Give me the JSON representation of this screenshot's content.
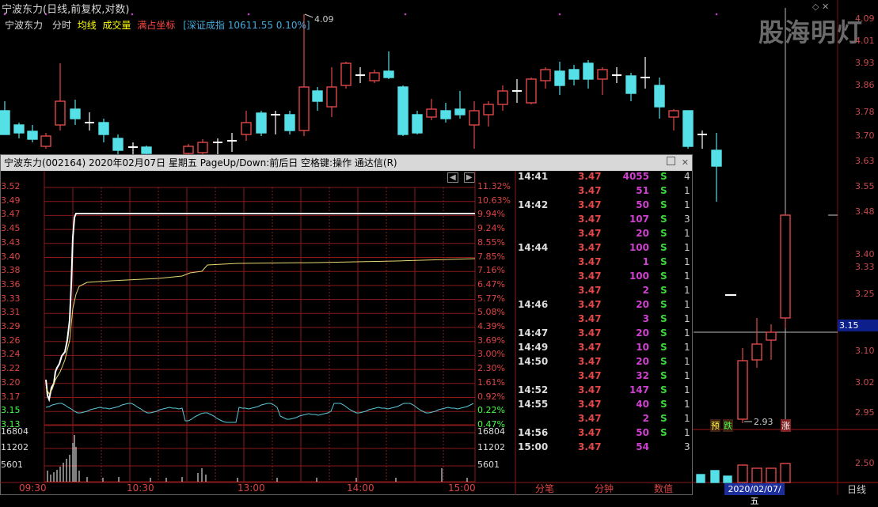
{
  "window_title": "宁波东力(日线,前复权,对数)",
  "watermark": "股海明灯",
  "top_icons": "◇ ✕",
  "right_axis": [
    "4.09",
    "4.01",
    "3.93",
    "3.86",
    "3.78",
    "3.70",
    "3.63",
    "3.55",
    "3.48",
    "3.40",
    "3.33",
    "3.25",
    "3.15",
    "3.10",
    "3.02",
    "2.95",
    "2.50"
  ],
  "current_price": "3.15",
  "annotations": {
    "high": "4.09",
    "low": "2.93",
    "yu": "预",
    "die": "跌",
    "zhang": "涨"
  },
  "bottom": {
    "date": "2020/02/07/五",
    "daily": "日线"
  },
  "popup": {
    "title": "宁波东力(002164)  2020年02月07日 星期五  PageUp/Down:前后日  空格键:操作  通达信(R)",
    "sub_name": "宁波东力",
    "sub_tabs": [
      "分时",
      "均线",
      "成交量",
      "满占坐标"
    ],
    "index_info": "[深证成指 10611.55 0.10%]",
    "y_prices": [
      "3.52",
      "3.49",
      "3.47",
      "3.45",
      "3.43",
      "3.40",
      "3.38",
      "3.36",
      "3.33",
      "3.31",
      "3.29",
      "3.26",
      "3.24",
      "3.22",
      "3.20",
      "3.17",
      "3.15",
      "3.13"
    ],
    "y_pcts": [
      "11.32%",
      "10.63%",
      "9.94%",
      "9.24%",
      "8.55%",
      "7.85%",
      "7.16%",
      "6.47%",
      "5.77%",
      "5.08%",
      "4.39%",
      "3.69%",
      "3.00%",
      "2.30%",
      "1.61%",
      "0.92%",
      "0.22%",
      "0.47%"
    ],
    "vol_ticks": [
      "16804",
      "11202",
      "5601"
    ],
    "x_ticks": [
      "09:30",
      "10:30",
      "13:00",
      "14:00",
      "15:00"
    ],
    "trades": [
      {
        "time": "14:41",
        "price": "3.47",
        "vol": "4055",
        "bs": "S",
        "cnt": "4"
      },
      {
        "time": "",
        "price": "3.47",
        "vol": "51",
        "bs": "S",
        "cnt": "1"
      },
      {
        "time": "14:42",
        "price": "3.47",
        "vol": "50",
        "bs": "S",
        "cnt": "1"
      },
      {
        "time": "",
        "price": "3.47",
        "vol": "107",
        "bs": "S",
        "cnt": "3"
      },
      {
        "time": "",
        "price": "3.47",
        "vol": "20",
        "bs": "S",
        "cnt": "1"
      },
      {
        "time": "14:44",
        "price": "3.47",
        "vol": "100",
        "bs": "S",
        "cnt": "1"
      },
      {
        "time": "",
        "price": "3.47",
        "vol": "1",
        "bs": "S",
        "cnt": "1"
      },
      {
        "time": "",
        "price": "3.47",
        "vol": "100",
        "bs": "S",
        "cnt": "1"
      },
      {
        "time": "",
        "price": "3.47",
        "vol": "2",
        "bs": "S",
        "cnt": "1"
      },
      {
        "time": "14:46",
        "price": "3.47",
        "vol": "20",
        "bs": "S",
        "cnt": "1"
      },
      {
        "time": "",
        "price": "3.47",
        "vol": "3",
        "bs": "S",
        "cnt": "1"
      },
      {
        "time": "14:47",
        "price": "3.47",
        "vol": "20",
        "bs": "S",
        "cnt": "1"
      },
      {
        "time": "14:49",
        "price": "3.47",
        "vol": "10",
        "bs": "S",
        "cnt": "1"
      },
      {
        "time": "14:50",
        "price": "3.47",
        "vol": "20",
        "bs": "S",
        "cnt": "1"
      },
      {
        "time": "",
        "price": "3.47",
        "vol": "32",
        "bs": "S",
        "cnt": "1"
      },
      {
        "time": "14:52",
        "price": "3.47",
        "vol": "147",
        "bs": "S",
        "cnt": "1"
      },
      {
        "time": "14:55",
        "price": "3.47",
        "vol": "40",
        "bs": "S",
        "cnt": "1"
      },
      {
        "time": "",
        "price": "3.47",
        "vol": "2",
        "bs": "S",
        "cnt": "1"
      },
      {
        "time": "14:56",
        "price": "3.47",
        "vol": "50",
        "bs": "S",
        "cnt": "1"
      },
      {
        "time": "15:00",
        "price": "3.47",
        "vol": "54",
        "bs": "",
        "cnt": "3"
      }
    ],
    "bottom_tabs": [
      "分笔",
      "分钟",
      "数值"
    ]
  },
  "colors": {
    "up": "#e04848",
    "down": "#55e0e8",
    "grid": "#8a1a1a",
    "bg": "#000000",
    "vol_purple": "#d040d0",
    "s_green": "#3ad63a"
  }
}
